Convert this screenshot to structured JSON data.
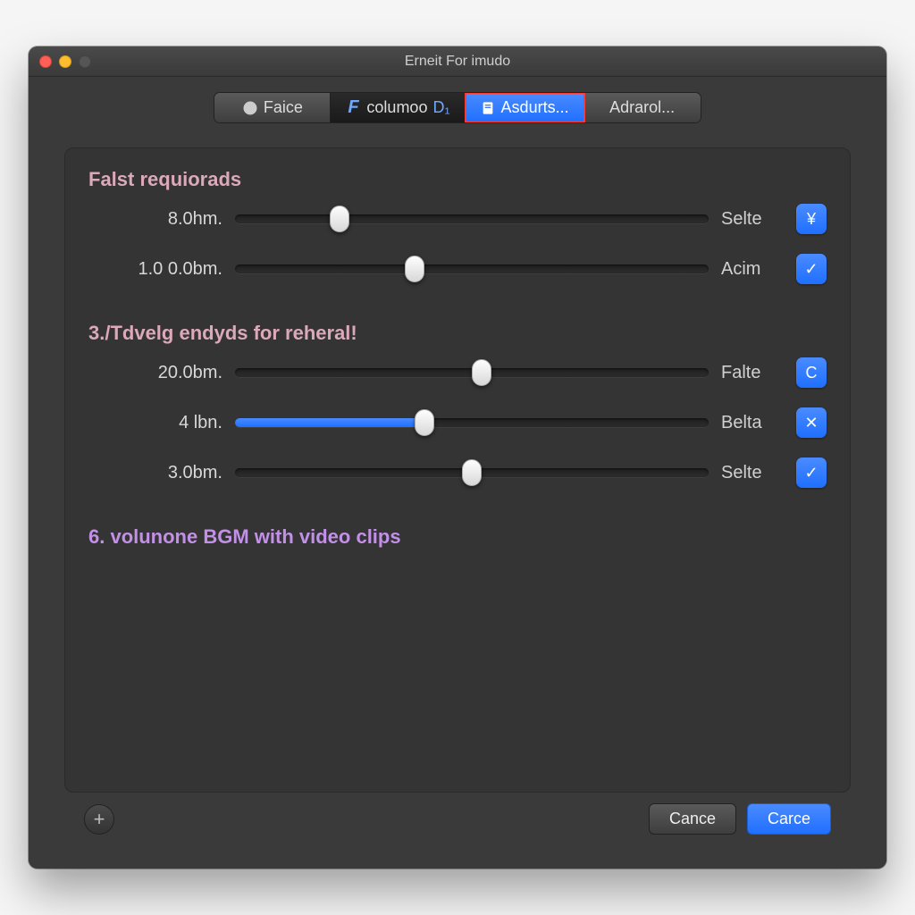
{
  "window": {
    "title": "Erneit For imudo"
  },
  "tabs": [
    {
      "label": "Faice",
      "icon": "gear-icon"
    },
    {
      "label": "columoo",
      "icon": "f-cursive-icon",
      "suffix": "D₁"
    },
    {
      "label": "Asdurts...",
      "icon": "doc-icon",
      "selected": true
    },
    {
      "label": "Adrarol..."
    }
  ],
  "section1": {
    "heading": "Falst requiorads",
    "rows": [
      {
        "value": "8.0hm.",
        "pos": 22,
        "right": "Selte",
        "badge": "¥"
      },
      {
        "value": "1.0 0.0bm.",
        "pos": 38,
        "right": "Acim",
        "badge": "✓"
      }
    ]
  },
  "section2": {
    "heading": "3./Tdvelg endyds for reheral!",
    "rows": [
      {
        "value": "20.0bm.",
        "pos": 52,
        "right": "Falte",
        "badge": "C"
      },
      {
        "value": "4 lbn.",
        "pos": 40,
        "right": "Belta",
        "badge": "✕",
        "fill": true
      },
      {
        "value": "3.0bm.",
        "pos": 50,
        "right": "Selte",
        "badge": "✓"
      }
    ]
  },
  "section3": {
    "heading": "6. volunone BGM with video clips"
  },
  "footer": {
    "cancel": "Cance",
    "confirm": "Carce"
  }
}
